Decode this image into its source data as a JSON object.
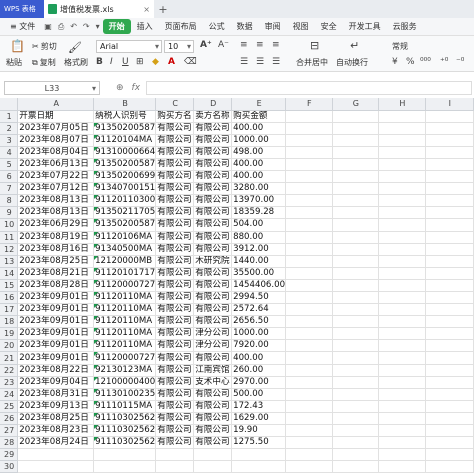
{
  "titlebar": {
    "app": "WPS 表格",
    "doc": "增值税发票.xls",
    "close": "×",
    "new_tab": "+"
  },
  "menu": {
    "file": "≡ 文件",
    "items": [
      "开始",
      "插入",
      "页面布局",
      "公式",
      "数据",
      "审阅",
      "视图",
      "安全",
      "开发工具",
      "云服务"
    ]
  },
  "toolbar": {
    "paste": "粘贴",
    "cut": "剪切",
    "copy": "复制",
    "format_painter": "格式刷",
    "font": "Arial",
    "size": "10",
    "merge": "合并居中",
    "wrap": "自动换行",
    "number_format": "常规"
  },
  "formula": {
    "name_box": "L33",
    "zoom_icon": "⊕",
    "fx": "fx",
    "value": ""
  },
  "columns": [
    "A",
    "B",
    "C",
    "D",
    "E",
    "F",
    "G",
    "H",
    "I"
  ],
  "rows": [
    [
      "开票日期",
      "纳税人识别号",
      "购买方名",
      "卖方名称",
      "购买金额"
    ],
    [
      "2023年07月05日",
      "91350200587",
      "有限公司",
      "有限公司",
      "400.00"
    ],
    [
      "2023年08月07日",
      "91120104MA",
      "有限公司",
      "有限公司",
      "1000.00"
    ],
    [
      "2023年08月04日",
      "91310000664",
      "有限公司",
      "有限公司",
      "498.00"
    ],
    [
      "2023年06月13日",
      "91350200587",
      "有限公司",
      "有限公司",
      "400.00"
    ],
    [
      "2023年07月22日",
      "91350200699",
      "有限公司",
      "有限公司",
      "400.00"
    ],
    [
      "2023年07月12日",
      "91340700151",
      "有限公司",
      "有限公司",
      "3280.00"
    ],
    [
      "2023年08月13日",
      "91120110300",
      "有限公司",
      "有限公司",
      "13970.00"
    ],
    [
      "2023年08月13日",
      "91350211705",
      "有限公司",
      "有限公司",
      "18359.28"
    ],
    [
      "2023年06月29日",
      "91350200587",
      "有限公司",
      "有限公司",
      "504.00"
    ],
    [
      "2023年08月19日",
      "91120106MA",
      "有限公司",
      "有限公司",
      "880.00"
    ],
    [
      "2023年08月16日",
      "91340500MA",
      "有限公司",
      "有限公司",
      "3912.00"
    ],
    [
      "2023年08月25日",
      "12120000MB",
      "有限公司",
      "木研究院",
      "1440.00"
    ],
    [
      "2023年08月21日",
      "91120101717",
      "有限公司",
      "有限公司",
      "35500.00"
    ],
    [
      "2023年08月28日",
      "91120000727",
      "有限公司",
      "有限公司",
      "1454406.00"
    ],
    [
      "2023年09月01日",
      "91120110MA",
      "有限公司",
      "有限公司",
      "2994.50"
    ],
    [
      "2023年09月01日",
      "91120110MA",
      "有限公司",
      "有限公司",
      "2572.64"
    ],
    [
      "2023年09月01日",
      "91120110MA",
      "有限公司",
      "有限公司",
      "2656.50"
    ],
    [
      "2023年09月01日",
      "91120110MA",
      "有限公司",
      "津分公司",
      "1000.00"
    ],
    [
      "2023年09月01日",
      "91120110MA",
      "有限公司",
      "津分公司",
      "7920.00"
    ],
    [
      "2023年09月01日",
      "91120000727",
      "有限公司",
      "有限公司",
      "400.00"
    ],
    [
      "2023年08月22日",
      "92130123MA",
      "有限公司",
      "江南宾馆",
      "260.00"
    ],
    [
      "2023年09月04日",
      "12100000400",
      "有限公司",
      "支术中心",
      "2970.00"
    ],
    [
      "2023年08月31日",
      "91130100235",
      "有限公司",
      "有限公司",
      "500.00"
    ],
    [
      "2023年09月13日",
      "91110115MA",
      "有限公司",
      "有限公司",
      "172.43"
    ],
    [
      "2023年08月25日",
      "91110302562",
      "有限公司",
      "有限公司",
      "1629.00"
    ],
    [
      "2023年08月23日",
      "91110302562",
      "有限公司",
      "有限公司",
      "19.90"
    ],
    [
      "2023年08月24日",
      "91110302562",
      "有限公司",
      "有限公司",
      "1275.50"
    ]
  ]
}
